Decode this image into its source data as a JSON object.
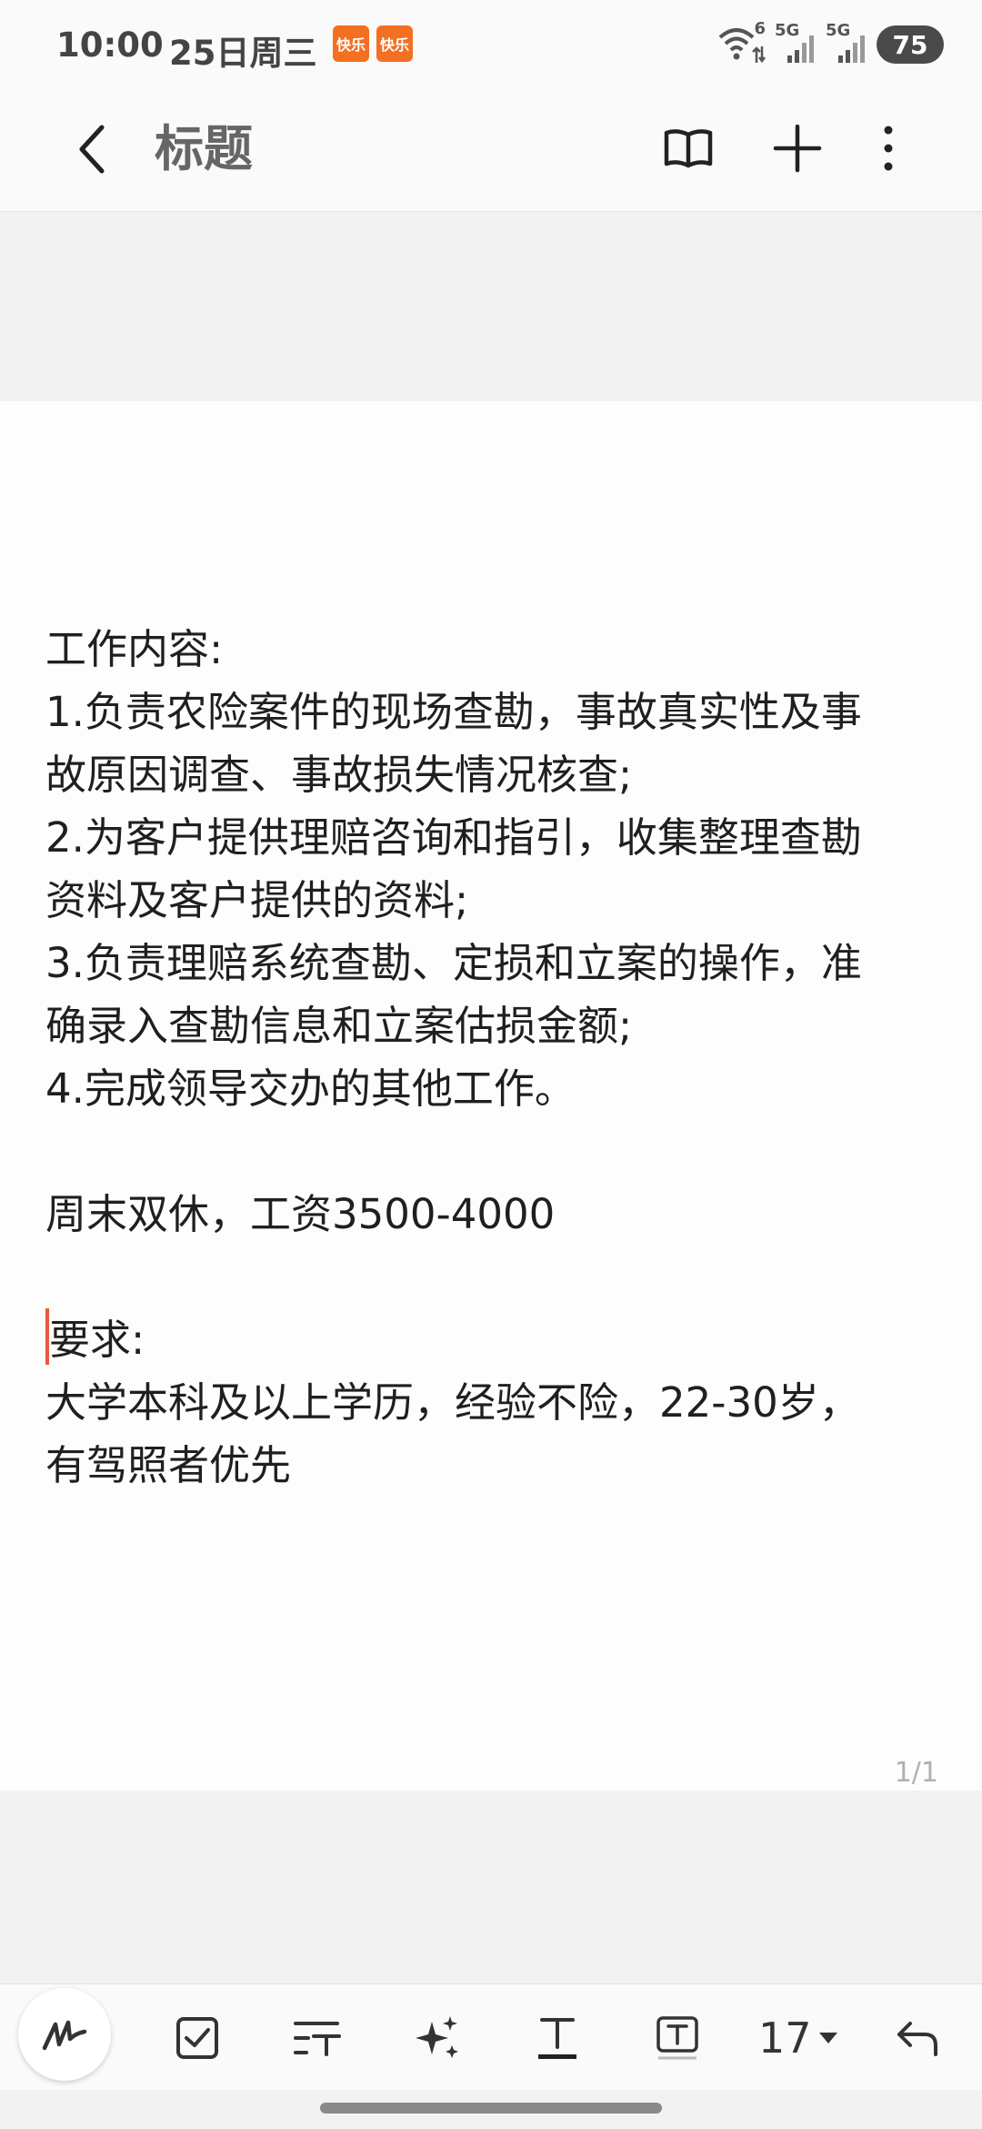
{
  "status_bar": {
    "time": "10:00",
    "date": "25日周三",
    "app_badges": [
      "快乐",
      "快乐"
    ],
    "network_labels": [
      "6",
      "5G",
      "5G"
    ],
    "battery": "75"
  },
  "title_bar": {
    "title": "标题",
    "icons": [
      "back-arrow-icon",
      "book-icon",
      "plus-icon",
      "more-vertical-icon"
    ]
  },
  "note": {
    "lines": [
      "工作内容:",
      "1.负责农险案件的现场查勘，事故真实性及事",
      "故原因调查、事故损失情况核查;",
      "2.为客户提供理赔咨询和指引，收集整理查勘",
      "资料及客户提供的资料;",
      "3.负责理赔系统查勘、定损和立案的操作，准",
      "确录入查勘信息和立案估损金额;",
      "4.完成领导交办的其他工作。",
      "",
      "周末双休，工资3500-4000",
      "",
      "要求:",
      "大学本科及以上学历，经验不险，22-30岁，",
      "有驾照者优先"
    ],
    "page_indicator": "1/1"
  },
  "toolbar": {
    "font_size": "17",
    "tools": [
      "pen-icon",
      "checkbox-icon",
      "text-format-icon",
      "ai-sparkle-icon",
      "text-style-icon",
      "text-box-icon",
      "font-size-dropdown",
      "undo-icon"
    ]
  },
  "colors": {
    "accent": "#f36f21",
    "cursor": "#e85a3a",
    "background": "#f2f2f2",
    "page": "#fdfdfd"
  }
}
